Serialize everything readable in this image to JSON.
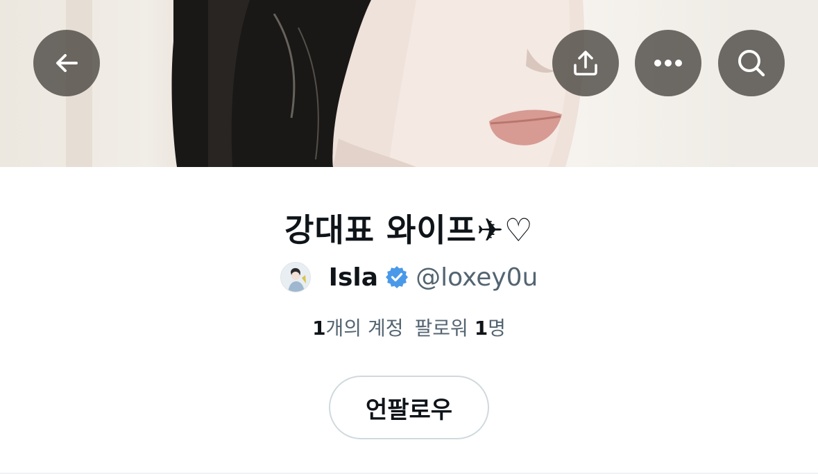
{
  "header": {
    "back_icon": "arrow-left-icon",
    "share_icon": "share-upload-icon",
    "more_icon": "more-horizontal-icon",
    "search_icon": "search-icon"
  },
  "profile": {
    "title": "강대표 와이프✈︎♡",
    "display_name": "Isla",
    "username": "@loxey0u",
    "verified": true,
    "verified_color": "#4a99e9"
  },
  "followers": {
    "prefix_count": "1",
    "prefix_text": "개의 계정",
    "label": "팔로워",
    "count": "1",
    "suffix": "명"
  },
  "actions": {
    "unfollow_label": "언팔로우"
  }
}
